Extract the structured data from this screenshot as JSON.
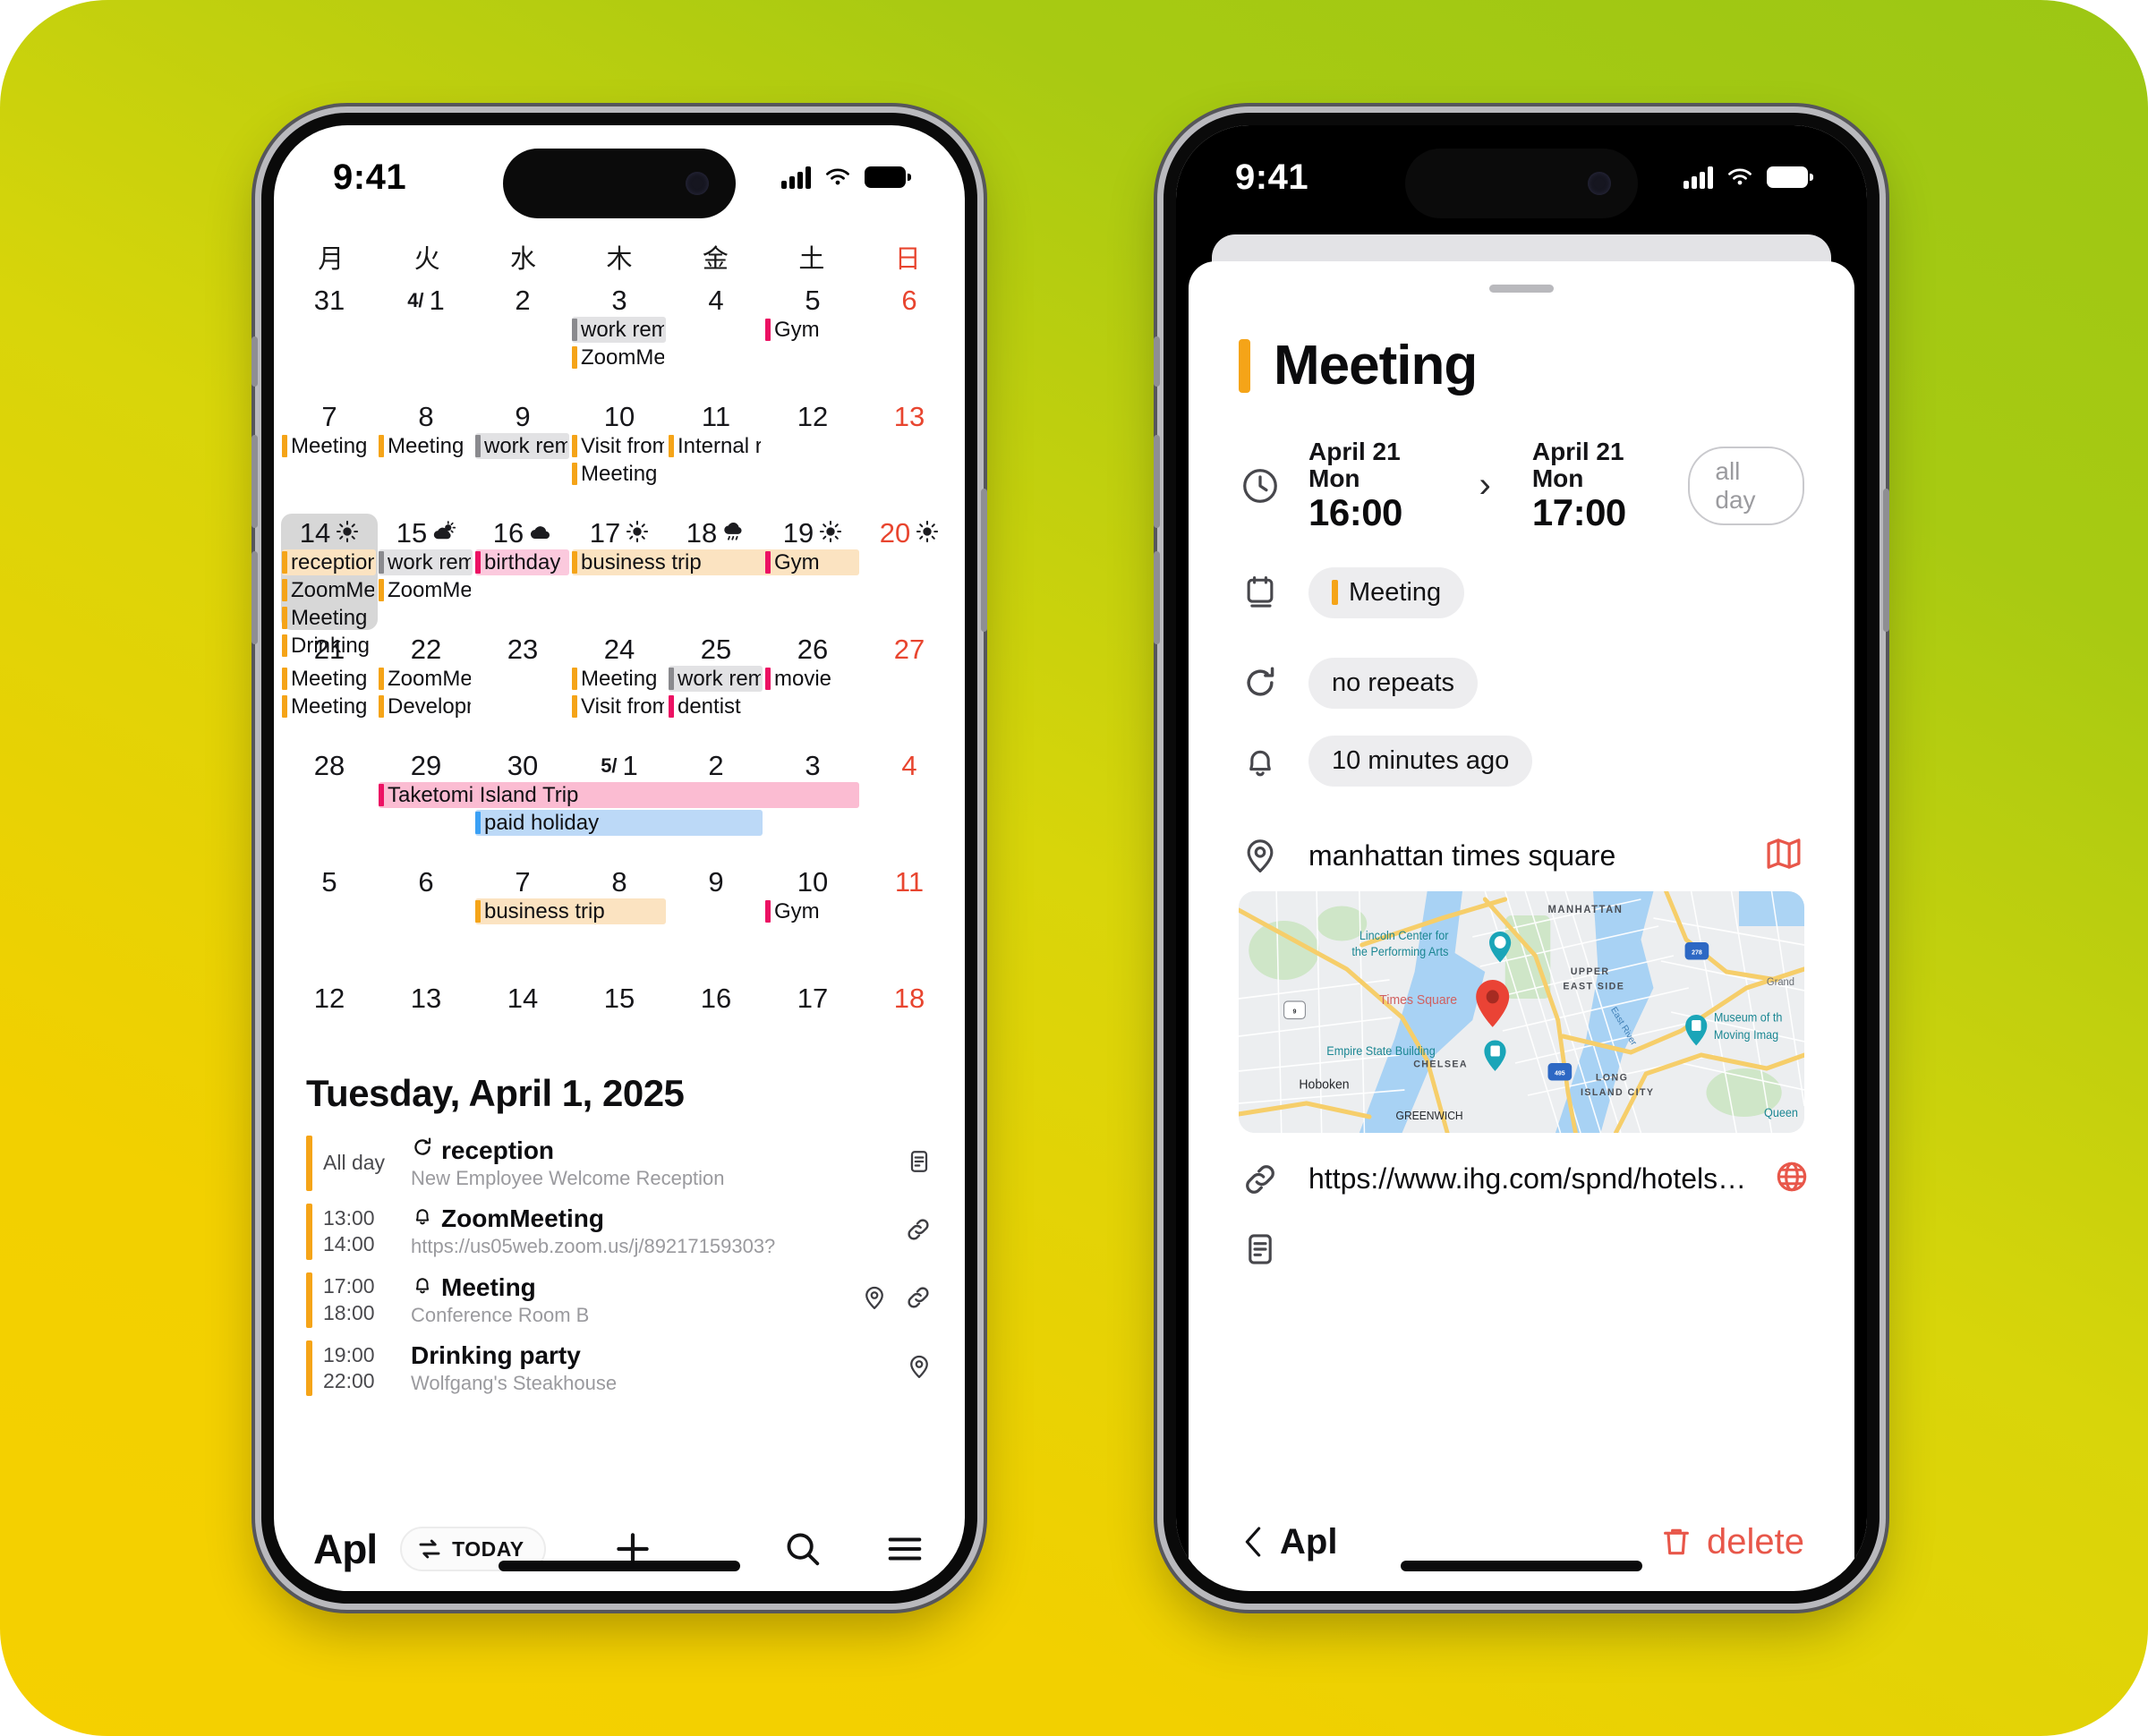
{
  "background": {
    "from": "#f5d000",
    "to": "#9cc714"
  },
  "colors": {
    "orange": "#f5a418",
    "pink": "#ec1163",
    "blue": "#3aa0f5",
    "red_text": "#e8452f",
    "delete_red": "#e8574a",
    "chip_gray": "#d9d9d9",
    "chip_peach": "#fbe3c1",
    "chip_pink_bg": "#fbc9dd",
    "chip_trip_pink": "#fbbcd2",
    "chip_blue_bg": "#bcd9f7"
  },
  "left_phone": {
    "statusbar": {
      "time": "9:41",
      "signal_icon": "cellular-signal-icon",
      "wifi_icon": "wifi-icon",
      "battery_icon": "battery-icon"
    },
    "calendar": {
      "weekdays": [
        {
          "label": "月",
          "sunday": false
        },
        {
          "label": "火",
          "sunday": false
        },
        {
          "label": "水",
          "sunday": false
        },
        {
          "label": "木",
          "sunday": false
        },
        {
          "label": "金",
          "sunday": false
        },
        {
          "label": "土",
          "sunday": false
        },
        {
          "label": "日",
          "sunday": true
        }
      ],
      "weeks": [
        {
          "days": [
            {
              "num": "31",
              "sunday": false,
              "today": false,
              "weather": ""
            },
            {
              "num": "1",
              "month_prefix": "4/",
              "sunday": false,
              "today": false,
              "weather": ""
            },
            {
              "num": "2",
              "sunday": false,
              "today": false,
              "weather": ""
            },
            {
              "num": "3",
              "sunday": false,
              "today": false,
              "weather": ""
            },
            {
              "num": "4",
              "sunday": false,
              "today": false,
              "weather": ""
            },
            {
              "num": "5",
              "sunday": false,
              "today": false,
              "weather": ""
            },
            {
              "num": "6",
              "sunday": true,
              "today": false,
              "weather": ""
            }
          ],
          "events": [
            {
              "label": "work rem",
              "start": 3,
              "span": 1,
              "row": 0,
              "bar": "#8a8a8e",
              "bg": "#e2e2e4"
            },
            {
              "label": "ZoomMee",
              "start": 3,
              "span": 1,
              "row": 1,
              "bar": "#f5a418",
              "bg": "transparent"
            },
            {
              "label": "Gym",
              "start": 5,
              "span": 1,
              "row": 0,
              "bar": "#ec1163",
              "bg": "transparent"
            }
          ]
        },
        {
          "days": [
            {
              "num": "7",
              "sunday": false,
              "today": false,
              "weather": ""
            },
            {
              "num": "8",
              "sunday": false,
              "today": false,
              "weather": ""
            },
            {
              "num": "9",
              "sunday": false,
              "today": false,
              "weather": ""
            },
            {
              "num": "10",
              "sunday": false,
              "today": false,
              "weather": ""
            },
            {
              "num": "11",
              "sunday": false,
              "today": false,
              "weather": ""
            },
            {
              "num": "12",
              "sunday": false,
              "today": false,
              "weather": ""
            },
            {
              "num": "13",
              "sunday": true,
              "today": false,
              "weather": ""
            }
          ],
          "events": [
            {
              "label": "Meeting",
              "start": 0,
              "span": 1,
              "row": 0,
              "bar": "#f5a418",
              "bg": "transparent"
            },
            {
              "label": "Meeting",
              "start": 1,
              "span": 1,
              "row": 0,
              "bar": "#f5a418",
              "bg": "transparent"
            },
            {
              "label": "work rem",
              "start": 2,
              "span": 1,
              "row": 0,
              "bar": "#8a8a8e",
              "bg": "#e2e2e4"
            },
            {
              "label": "Visit from",
              "start": 3,
              "span": 1,
              "row": 0,
              "bar": "#f5a418",
              "bg": "transparent"
            },
            {
              "label": "Meeting",
              "start": 3,
              "span": 1,
              "row": 1,
              "bar": "#f5a418",
              "bg": "transparent"
            },
            {
              "label": "Internal r",
              "start": 4,
              "span": 1,
              "row": 0,
              "bar": "#f5a418",
              "bg": "transparent"
            }
          ]
        },
        {
          "days": [
            {
              "num": "14",
              "sunday": false,
              "today": true,
              "weather": "sunny"
            },
            {
              "num": "15",
              "sunday": false,
              "today": false,
              "weather": "partly"
            },
            {
              "num": "16",
              "sunday": false,
              "today": false,
              "weather": "cloudy"
            },
            {
              "num": "17",
              "sunday": false,
              "today": false,
              "weather": "sunny"
            },
            {
              "num": "18",
              "sunday": false,
              "today": false,
              "weather": "storm"
            },
            {
              "num": "19",
              "sunday": false,
              "today": false,
              "weather": "sunny"
            },
            {
              "num": "20",
              "sunday": true,
              "today": false,
              "weather": "sunny"
            }
          ],
          "events": [
            {
              "label": "reception",
              "start": 0,
              "span": 1,
              "row": 0,
              "bar": "#f5a418",
              "bg": "#fbe3c1"
            },
            {
              "label": "ZoomMee",
              "start": 0,
              "span": 1,
              "row": 1,
              "bar": "#f5a418",
              "bg": "transparent"
            },
            {
              "label": "Meeting",
              "start": 0,
              "span": 1,
              "row": 2,
              "bar": "#f5a418",
              "bg": "transparent"
            },
            {
              "label": "Drinking",
              "start": 0,
              "span": 1,
              "row": 3,
              "bar": "#f5a418",
              "bg": "transparent"
            },
            {
              "label": "work rem",
              "start": 1,
              "span": 1,
              "row": 0,
              "bar": "#8a8a8e",
              "bg": "#e2e2e4"
            },
            {
              "label": "ZoomMee",
              "start": 1,
              "span": 1,
              "row": 1,
              "bar": "#f5a418",
              "bg": "transparent"
            },
            {
              "label": "birthday",
              "start": 2,
              "span": 1,
              "row": 0,
              "bar": "#ec1163",
              "bg": "#fbc9dd"
            },
            {
              "label": "business trip",
              "start": 3,
              "span": 3,
              "row": 0,
              "bar": "#f5a418",
              "bg": "#fbe3c1"
            },
            {
              "label": "Gym",
              "start": 5,
              "span": 1,
              "row": 0,
              "bar": "#ec1163",
              "bg": "transparent"
            }
          ]
        },
        {
          "days": [
            {
              "num": "21",
              "sunday": false,
              "today": false,
              "weather": ""
            },
            {
              "num": "22",
              "sunday": false,
              "today": false,
              "weather": ""
            },
            {
              "num": "23",
              "sunday": false,
              "today": false,
              "weather": ""
            },
            {
              "num": "24",
              "sunday": false,
              "today": false,
              "weather": ""
            },
            {
              "num": "25",
              "sunday": false,
              "today": false,
              "weather": ""
            },
            {
              "num": "26",
              "sunday": false,
              "today": false,
              "weather": ""
            },
            {
              "num": "27",
              "sunday": true,
              "today": false,
              "weather": ""
            }
          ],
          "events": [
            {
              "label": "Meeting",
              "start": 0,
              "span": 1,
              "row": 0,
              "bar": "#f5a418",
              "bg": "transparent"
            },
            {
              "label": "Meeting",
              "start": 0,
              "span": 1,
              "row": 1,
              "bar": "#f5a418",
              "bg": "transparent"
            },
            {
              "label": "ZoomMee",
              "start": 1,
              "span": 1,
              "row": 0,
              "bar": "#f5a418",
              "bg": "transparent"
            },
            {
              "label": "Developm",
              "start": 1,
              "span": 1,
              "row": 1,
              "bar": "#f5a418",
              "bg": "transparent"
            },
            {
              "label": "Meeting",
              "start": 3,
              "span": 1,
              "row": 0,
              "bar": "#f5a418",
              "bg": "transparent"
            },
            {
              "label": "Visit from",
              "start": 3,
              "span": 1,
              "row": 1,
              "bar": "#f5a418",
              "bg": "transparent"
            },
            {
              "label": "work rem",
              "start": 4,
              "span": 1,
              "row": 0,
              "bar": "#8a8a8e",
              "bg": "#e2e2e4"
            },
            {
              "label": "dentist",
              "start": 4,
              "span": 1,
              "row": 1,
              "bar": "#ec1163",
              "bg": "transparent"
            },
            {
              "label": "movie",
              "start": 5,
              "span": 1,
              "row": 0,
              "bar": "#ec1163",
              "bg": "transparent"
            }
          ]
        },
        {
          "days": [
            {
              "num": "28",
              "sunday": false,
              "today": false,
              "weather": ""
            },
            {
              "num": "29",
              "sunday": false,
              "today": false,
              "weather": ""
            },
            {
              "num": "30",
              "sunday": false,
              "today": false,
              "weather": ""
            },
            {
              "num": "1",
              "month_prefix": "5/",
              "sunday": false,
              "today": false,
              "weather": ""
            },
            {
              "num": "2",
              "sunday": false,
              "today": false,
              "weather": ""
            },
            {
              "num": "3",
              "sunday": false,
              "today": false,
              "weather": ""
            },
            {
              "num": "4",
              "sunday": true,
              "today": false,
              "weather": ""
            }
          ],
          "events": [
            {
              "label": "Taketomi Island Trip",
              "start": 1,
              "span": 5,
              "row": 0,
              "bar": "#ec1163",
              "bg": "#fbbcd2"
            },
            {
              "label": "paid holiday",
              "start": 2,
              "span": 3,
              "row": 1,
              "bar": "#3aa0f5",
              "bg": "#bcd9f7"
            }
          ]
        },
        {
          "days": [
            {
              "num": "5",
              "sunday": false,
              "today": false,
              "weather": ""
            },
            {
              "num": "6",
              "sunday": false,
              "today": false,
              "weather": ""
            },
            {
              "num": "7",
              "sunday": false,
              "today": false,
              "weather": ""
            },
            {
              "num": "8",
              "sunday": false,
              "today": false,
              "weather": ""
            },
            {
              "num": "9",
              "sunday": false,
              "today": false,
              "weather": ""
            },
            {
              "num": "10",
              "sunday": false,
              "today": false,
              "weather": ""
            },
            {
              "num": "11",
              "sunday": true,
              "today": false,
              "weather": ""
            }
          ],
          "events": [
            {
              "label": "business trip",
              "start": 2,
              "span": 2,
              "row": 0,
              "bar": "#f5a418",
              "bg": "#fbe3c1"
            },
            {
              "label": "Gym",
              "start": 5,
              "span": 1,
              "row": 0,
              "bar": "#ec1163",
              "bg": "transparent"
            }
          ]
        },
        {
          "days": [
            {
              "num": "12",
              "sunday": false,
              "today": false,
              "weather": ""
            },
            {
              "num": "13",
              "sunday": false,
              "today": false,
              "weather": ""
            },
            {
              "num": "14",
              "sunday": false,
              "today": false,
              "weather": ""
            },
            {
              "num": "15",
              "sunday": false,
              "today": false,
              "weather": ""
            },
            {
              "num": "16",
              "sunday": false,
              "today": false,
              "weather": ""
            },
            {
              "num": "17",
              "sunday": false,
              "today": false,
              "weather": ""
            },
            {
              "num": "18",
              "sunday": true,
              "today": false,
              "weather": ""
            }
          ],
          "events": []
        }
      ]
    },
    "agenda": {
      "date_heading": "Tuesday, April 1, 2025",
      "events": [
        {
          "time_start": "All day",
          "time_end": "",
          "title": "reception",
          "subtitle": "New Employee Welcome Reception",
          "accent": "#f5a418",
          "lead_icon": "repeat-icon",
          "tail_icons": [
            "note-icon"
          ]
        },
        {
          "time_start": "13:00",
          "time_end": "14:00",
          "title": "ZoomMeeting",
          "subtitle": "https://us05web.zoom.us/j/89217159303?",
          "accent": "#f5a418",
          "lead_icon": "bell-icon",
          "tail_icons": [
            "link-icon"
          ]
        },
        {
          "time_start": "17:00",
          "time_end": "18:00",
          "title": "Meeting",
          "subtitle": "Conference Room B",
          "accent": "#f5a418",
          "lead_icon": "bell-icon",
          "tail_icons": [
            "pin-icon",
            "link-icon"
          ]
        },
        {
          "time_start": "19:00",
          "time_end": "22:00",
          "title": "Drinking party",
          "subtitle": "Wolfgang's Steakhouse",
          "accent": "#f5a418",
          "lead_icon": "",
          "tail_icons": [
            "pin-icon"
          ]
        }
      ]
    },
    "tabbar": {
      "brand": "Apl",
      "today_label": "TODAY",
      "today_icon": "sync-icon",
      "add_icon": "plus-icon",
      "search_icon": "search-icon",
      "menu_icon": "hamburger-menu-icon"
    }
  },
  "right_phone": {
    "statusbar": {
      "time": "9:41",
      "signal_icon": "cellular-signal-icon",
      "wifi_icon": "wifi-icon",
      "battery_icon": "battery-icon"
    },
    "detail": {
      "title": "Meeting",
      "accent": "#f5a418",
      "time_icon": "clock-icon",
      "start_day": "April 21 Mon",
      "start_time": "16:00",
      "arrow": "›",
      "end_day": "April 21 Mon",
      "end_time": "17:00",
      "all_day_label": "all day",
      "calendar_icon": "calendar-icon",
      "calendar_tag": "Meeting",
      "repeat_icon": "repeat-icon",
      "repeat_value": "no repeats",
      "alert_icon": "bell-icon",
      "alert_value": "10 minutes ago",
      "location_icon": "pin-icon",
      "location": "manhattan times square",
      "map_action_icon": "map-icon",
      "map": {
        "pin_label": "Times Square",
        "labels": [
          "MANHATTAN",
          "UPPER EAST SIDE",
          "Lincoln Center for the Performing Arts",
          "Times Square",
          "Empire State Building",
          "CHELSEA",
          "Hoboken",
          "LONG ISLAND CITY",
          "Museum of the Moving Image",
          "GREENWICH",
          "Queen",
          "Grand",
          "East River",
          "9",
          "278",
          "495"
        ]
      },
      "link_icon": "link-icon",
      "url": "https://www.ihg.com/spnd/hotels…",
      "url_action_icon": "globe-icon",
      "note_icon": "note-icon"
    },
    "bottom": {
      "back_icon": "chevron-left-icon",
      "back_label": "Apl",
      "delete_icon": "trash-icon",
      "delete_label": "delete"
    }
  }
}
